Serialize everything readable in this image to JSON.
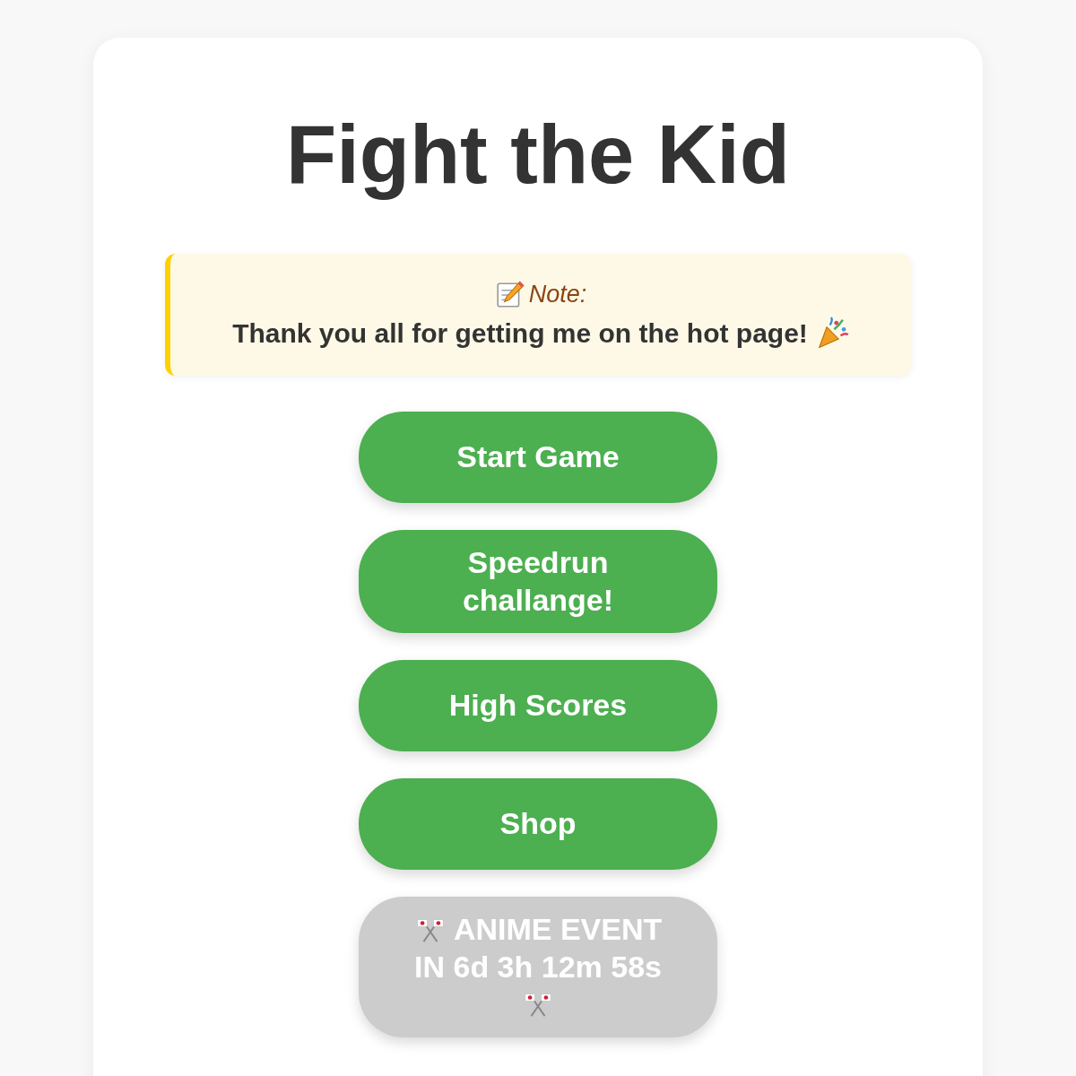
{
  "title": "Fight the Kid",
  "note": {
    "label": "Note:",
    "message": "Thank you all for getting me on the hot page!"
  },
  "buttons": [
    {
      "label": "Start Game",
      "kind": "plain",
      "disabled": false
    },
    {
      "label": "Speedrun challange!",
      "kind": "plain",
      "disabled": false
    },
    {
      "label": "High Scores",
      "kind": "plain",
      "disabled": false
    },
    {
      "label": "Shop",
      "kind": "plain",
      "disabled": false
    },
    {
      "label": "ANIME EVENT IN 6d 3h 12m 58s",
      "kind": "event",
      "disabled": true
    }
  ]
}
